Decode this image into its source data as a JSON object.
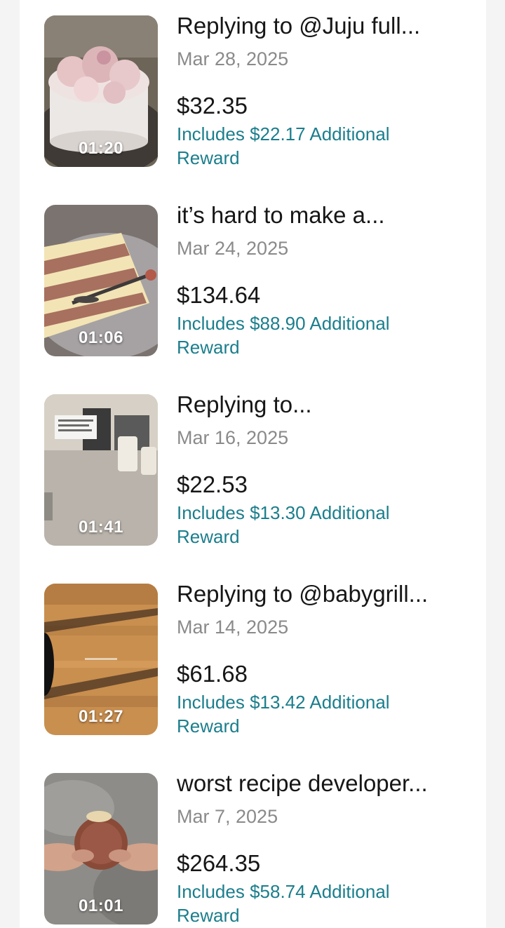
{
  "videos": [
    {
      "title": "Replying to @Juju full...",
      "date": "Mar 28, 2025",
      "amount": "$32.35",
      "reward": "Includes $22.17 Additional Reward",
      "duration": "01:20"
    },
    {
      "title": "it’s hard to make a...",
      "date": "Mar 24, 2025",
      "amount": "$134.64",
      "reward": "Includes $88.90 Additional Reward",
      "duration": "01:06"
    },
    {
      "title": "Replying to...",
      "date": "Mar 16, 2025",
      "amount": "$22.53",
      "reward": "Includes $13.30 Additional Reward",
      "duration": "01:41"
    },
    {
      "title": "Replying to @babygrill...",
      "date": "Mar 14, 2025",
      "amount": "$61.68",
      "reward": "Includes $13.42 Additional Reward",
      "duration": "01:27"
    },
    {
      "title": "worst recipe developer...",
      "date": "Mar 7, 2025",
      "amount": "$264.35",
      "reward": "Includes $58.74 Additional Reward",
      "duration": "01:01"
    }
  ],
  "colors": {
    "reward": "#1b7e8c",
    "date": "#8a8a8a",
    "text": "#161616"
  }
}
